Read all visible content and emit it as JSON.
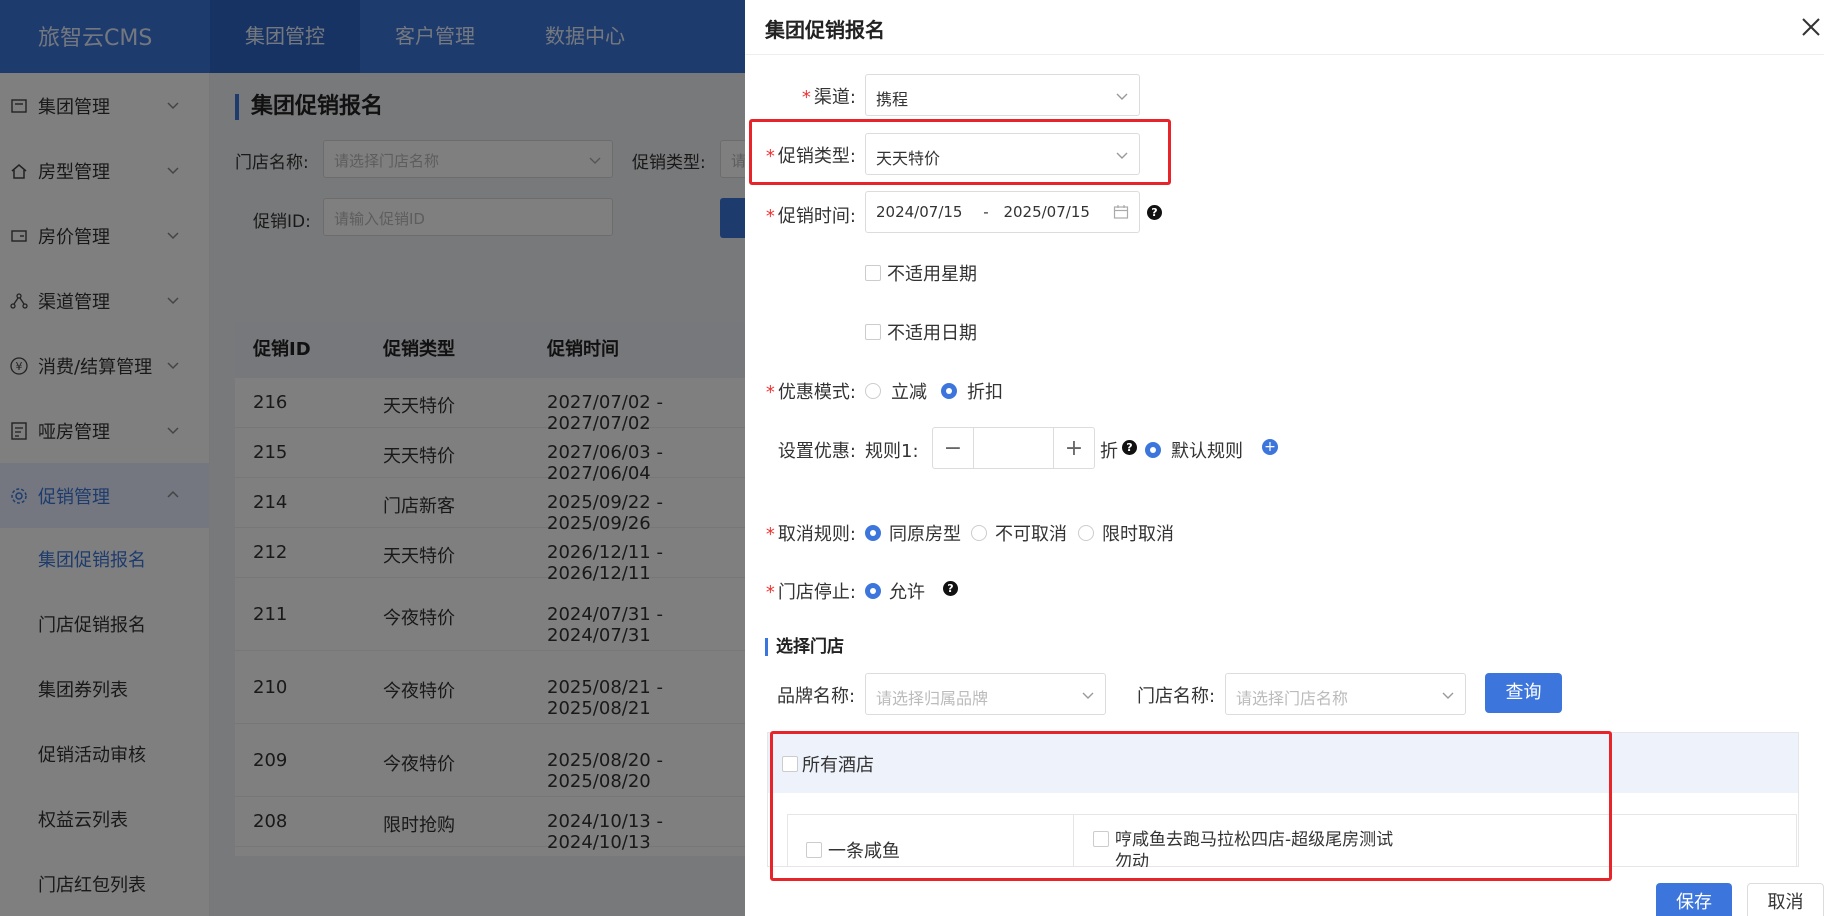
{
  "app": {
    "logo": "旅智云CMS"
  },
  "top_nav": [
    "集团管控",
    "客户管理",
    "数据中心"
  ],
  "sidebar": {
    "items": [
      {
        "label": "集团管理",
        "icon": "group-icon"
      },
      {
        "label": "房型管理",
        "icon": "home-icon"
      },
      {
        "label": "房价管理",
        "icon": "wallet-icon"
      },
      {
        "label": "渠道管理",
        "icon": "network-icon"
      },
      {
        "label": "消费/结算管理",
        "icon": "yen-icon"
      },
      {
        "label": "哑房管理",
        "icon": "report-icon"
      },
      {
        "label": "促销管理",
        "icon": "gear-icon"
      }
    ],
    "sub_items": [
      "集团促销报名",
      "门店促销报名",
      "集团券列表",
      "促销活动审核",
      "权益云列表",
      "门店红包列表"
    ]
  },
  "main": {
    "title": "集团促销报名",
    "filters": {
      "store_label": "门店名称:",
      "store_placeholder": "请选择门店名称",
      "type_label": "促销类型:",
      "type_placeholder": "请",
      "id_label": "促销ID:",
      "id_placeholder": "请输入促销ID"
    },
    "table": {
      "headers": [
        "促销ID",
        "促销类型",
        "促销时间"
      ],
      "rows": [
        [
          "216",
          "天天特价",
          "2027/07/02 - 2027/07/02"
        ],
        [
          "215",
          "天天特价",
          "2027/06/03 - 2027/06/04"
        ],
        [
          "214",
          "门店新客",
          "2025/09/22 - 2025/09/26"
        ],
        [
          "212",
          "天天特价",
          "2026/12/11 - 2026/12/11"
        ],
        [
          "211",
          "今夜特价",
          "2024/07/31 - 2024/07/31"
        ],
        [
          "210",
          "今夜特价",
          "2025/08/21 - 2025/08/21"
        ],
        [
          "209",
          "今夜特价",
          "2025/08/20 - 2025/08/20"
        ],
        [
          "208",
          "限时抢购",
          "2024/10/13 - 2024/10/13"
        ]
      ]
    }
  },
  "drawer": {
    "title": "集团促销报名",
    "channel": {
      "label": "渠道:",
      "value": "携程"
    },
    "promo_type": {
      "label": "促销类型:",
      "value": "天天特价"
    },
    "promo_time": {
      "label": "促销时间:",
      "start": "2024/07/15",
      "sep": "-",
      "end": "2025/07/15"
    },
    "exclude_weekday": "不适用星期",
    "exclude_date": "不适用日期",
    "discount_mode": {
      "label": "优惠模式:",
      "options": [
        "立减",
        "折扣"
      ],
      "selected": "折扣"
    },
    "discount_setting": {
      "label": "设置优惠:",
      "rule_label": "规则1:",
      "unit": "折",
      "default_rule": "默认规则"
    },
    "cancel_rule": {
      "label": "取消规则:",
      "options": [
        "同原房型",
        "不可取消",
        "限时取消"
      ],
      "selected": "同原房型"
    },
    "store_stop": {
      "label": "门店停止:",
      "option": "允许"
    },
    "select_store": {
      "title": "选择门店",
      "brand_label": "品牌名称:",
      "brand_placeholder": "请选择归属品牌",
      "store_label": "门店名称:",
      "store_placeholder": "请选择门店名称",
      "query_button": "查询",
      "all_hotels": "所有酒店",
      "brand_item": "一条咸鱼",
      "hotel_item": "哼咸鱼去跑马拉松四店-超级尾房测试",
      "hotel_item_cut": "勿动"
    },
    "save_button": "保存",
    "cancel_button": "取消"
  },
  "colors": {
    "accent": "#3c76dd",
    "highlight": "#e8242b",
    "required": "#e33333"
  }
}
